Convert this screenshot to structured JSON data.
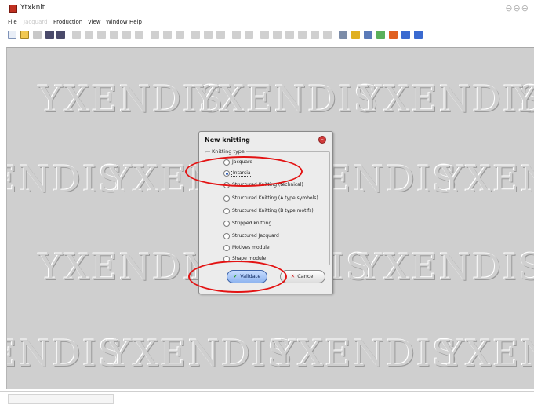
{
  "window": {
    "app_icon": "ytxknit-app-icon",
    "title": "Ytxknit",
    "controls": "⊖⊖⊖"
  },
  "menubar": {
    "items": [
      "File",
      "Jacquard",
      "Production",
      "View",
      "Window",
      "Help"
    ]
  },
  "watermark": {
    "text": "YXENDIS"
  },
  "dialog": {
    "title": "New knitting",
    "group_label": "Knitting type",
    "options": [
      {
        "label": "Jacquard",
        "checked": false
      },
      {
        "label": "Intarsia",
        "checked": true
      },
      {
        "label": "Structured Knitting (technical)",
        "checked": false
      },
      {
        "label": "Structured Knitting (A type symbols)",
        "checked": false
      },
      {
        "label": "Structured Knitting (B type motifs)",
        "checked": false
      },
      {
        "label": "Stripped knitting",
        "checked": false
      },
      {
        "label": "Structured Jacquard",
        "checked": false
      },
      {
        "label": "Motives module",
        "checked": false
      },
      {
        "label": "Shape module",
        "checked": false
      }
    ],
    "validate_label": "Validate",
    "cancel_label": "Cancel"
  },
  "colors": {
    "accent": "#e31313",
    "workspace": "#cfcfcf",
    "validate": "#8fb4ef"
  }
}
